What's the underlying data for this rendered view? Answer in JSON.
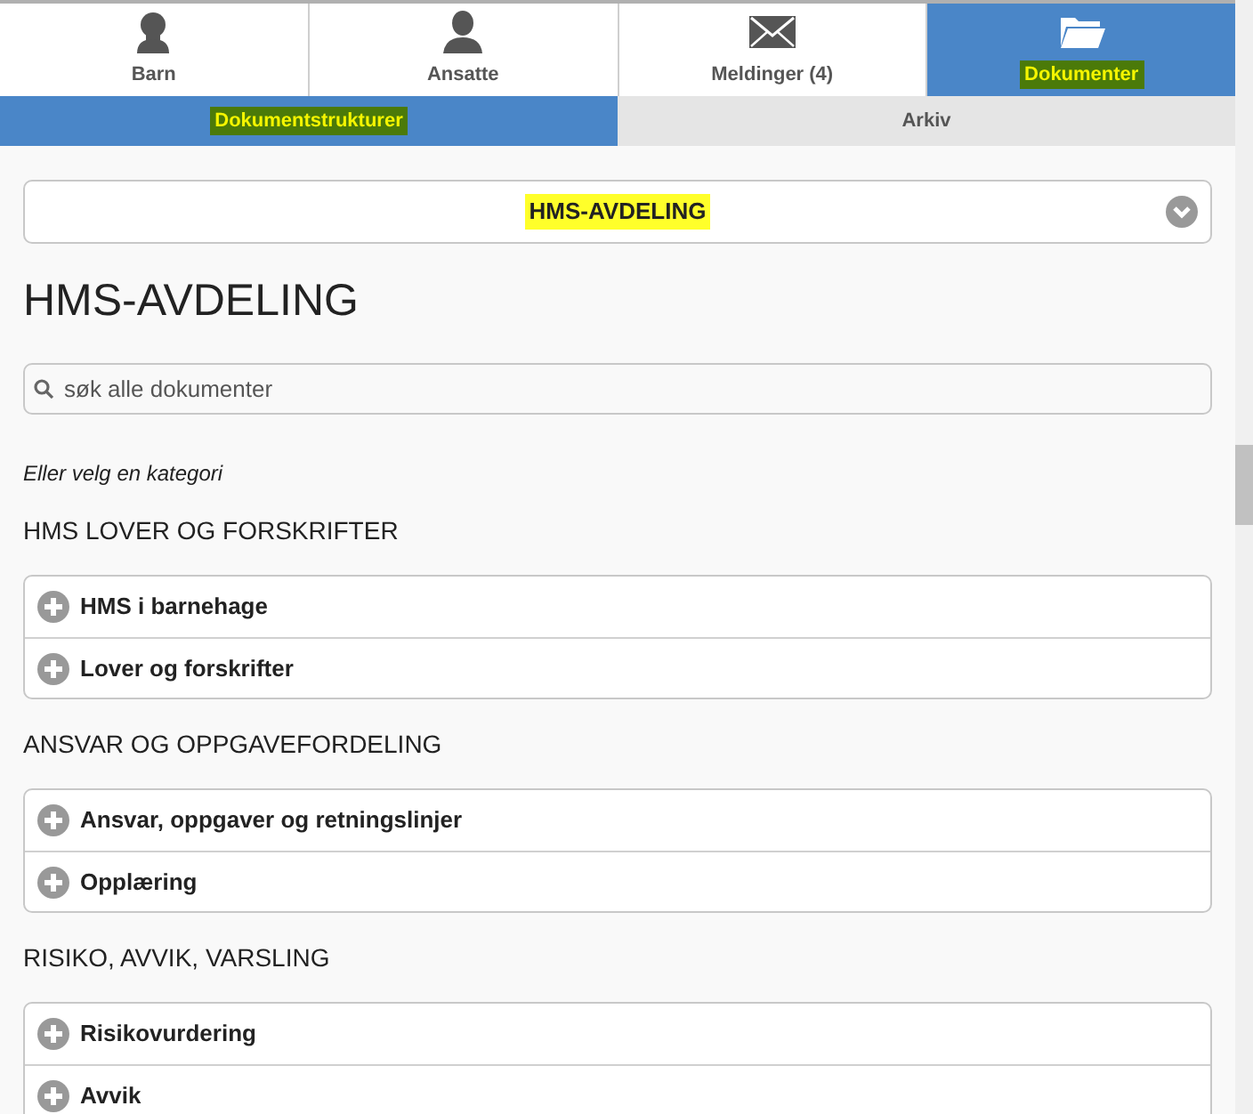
{
  "main_tabs": [
    {
      "label": "Barn",
      "kind": "child",
      "selected": false,
      "highlighted": false
    },
    {
      "label": "Ansatte",
      "kind": "person",
      "selected": false,
      "highlighted": false
    },
    {
      "label": "Meldinger (4)",
      "kind": "envelope",
      "selected": false,
      "highlighted": false
    },
    {
      "label": "Dokumenter",
      "kind": "folder",
      "selected": true,
      "highlighted": true
    }
  ],
  "sub_tabs": [
    {
      "label": "Dokumentstrukturer",
      "selected": true,
      "highlighted": true
    },
    {
      "label": "Arkiv",
      "selected": false,
      "highlighted": false
    }
  ],
  "department_select": {
    "value": "HMS-AVDELING",
    "highlighted": true
  },
  "heading": "HMS-AVDELING",
  "search": {
    "placeholder": "søk alle dokumenter"
  },
  "category_hint": "Eller velg en kategori",
  "sections": [
    {
      "title": "HMS LOVER OG FORSKRIFTER",
      "items": [
        {
          "label": "HMS i barnehage",
          "expanded": false
        },
        {
          "label": "Lover og forskrifter",
          "expanded": false
        }
      ]
    },
    {
      "title": "ANSVAR OG OPPGAVEFORDELING",
      "items": [
        {
          "label": "Ansvar, oppgaver og retningslinjer",
          "expanded": false
        },
        {
          "label": "Opplæring",
          "expanded": false
        }
      ]
    },
    {
      "title": "RISIKO, AVVIK, VARSLING",
      "items": [
        {
          "label": "Risikovurdering",
          "expanded": false
        },
        {
          "label": "Avvik",
          "expanded": false
        }
      ]
    }
  ]
}
